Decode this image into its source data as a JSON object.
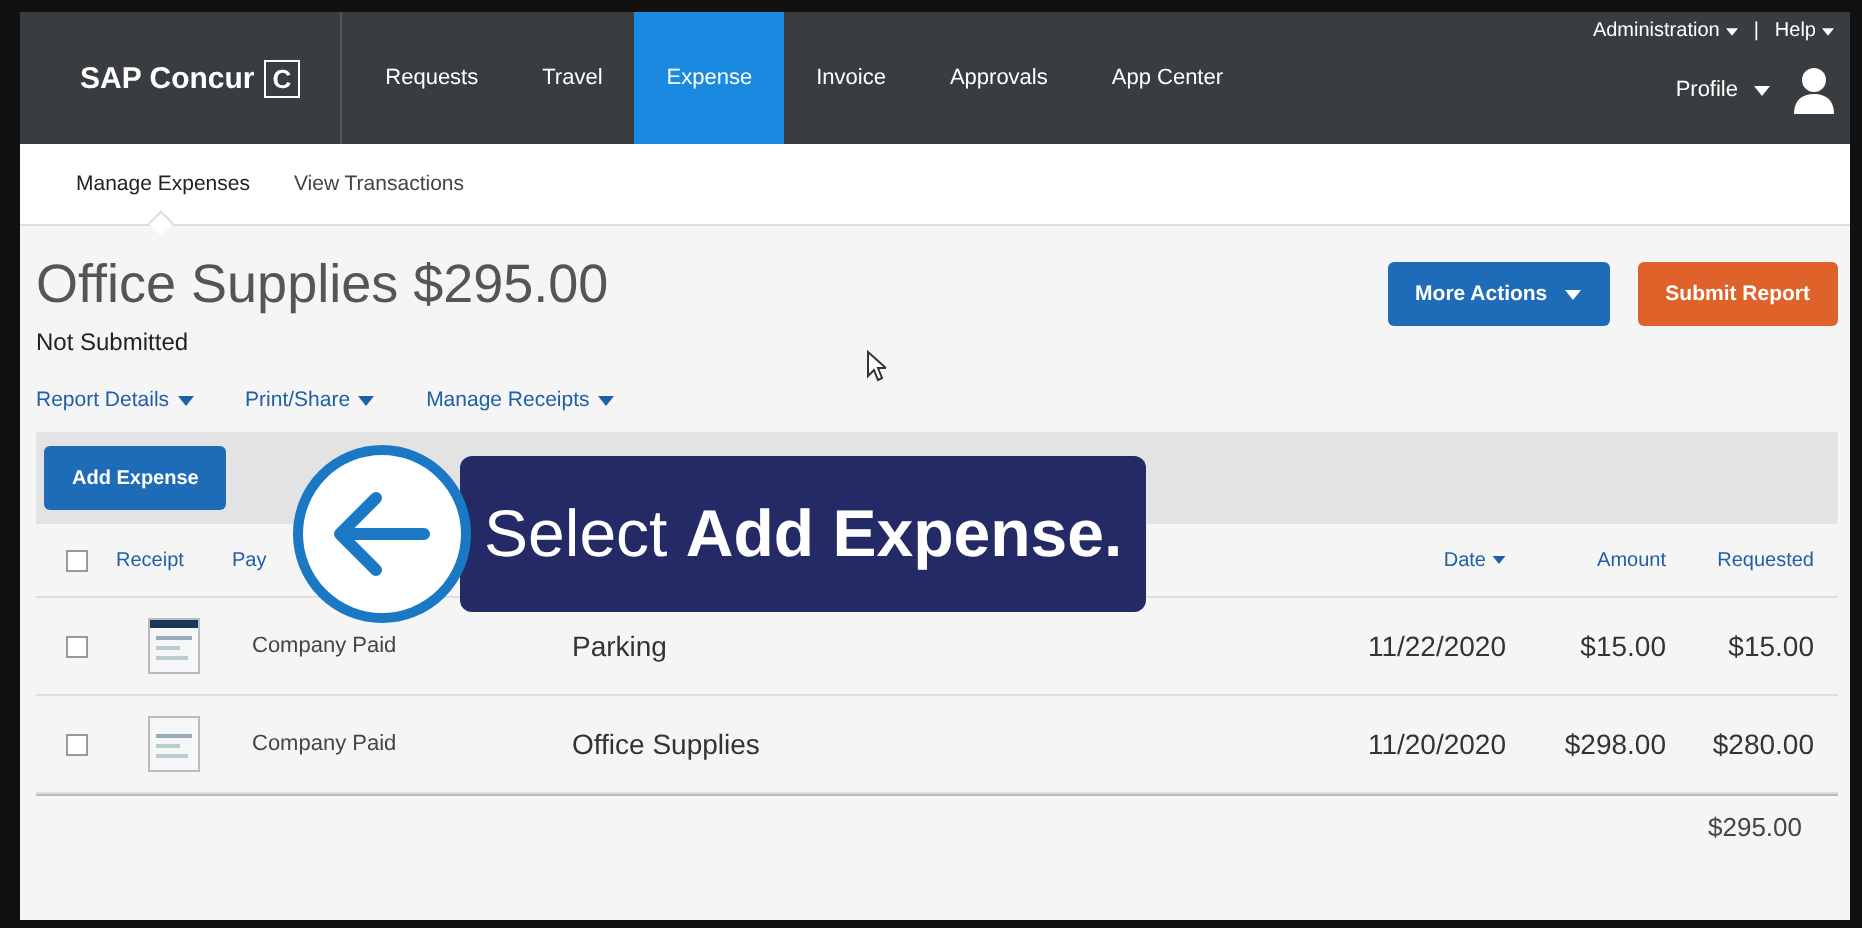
{
  "nav": {
    "brand": "SAP Concur",
    "brand_mark": "C",
    "tabs": [
      {
        "label": "Requests",
        "selected": false
      },
      {
        "label": "Travel",
        "selected": false
      },
      {
        "label": "Expense",
        "selected": true
      },
      {
        "label": "Invoice",
        "selected": false
      },
      {
        "label": "Approvals",
        "selected": false
      },
      {
        "label": "App Center",
        "selected": false
      }
    ],
    "admin": "Administration",
    "separator": "|",
    "help": "Help",
    "profile": "Profile"
  },
  "subnav": [
    {
      "label": "Manage Expenses",
      "selected": true
    },
    {
      "label": "View Transactions",
      "selected": false
    }
  ],
  "report": {
    "title": "Office Supplies $295.00",
    "status": "Not Submitted",
    "more_actions": "More Actions",
    "submit": "Submit Report"
  },
  "menus": [
    "Report Details",
    "Print/Share",
    "Manage Receipts"
  ],
  "toolbar": {
    "add_expense": "Add Expense"
  },
  "table": {
    "select_all_checked": false,
    "columns": [
      "Receipt",
      "Pay",
      "Date",
      "Amount",
      "Requested"
    ],
    "rows": [
      {
        "checked": false,
        "payment": "Company Paid",
        "expense_type": "Parking",
        "date": "11/22/2020",
        "amount": "$15.00",
        "requested": "$15.00"
      },
      {
        "checked": false,
        "payment": "Company Paid",
        "expense_type": "Office Supplies",
        "date": "11/20/2020",
        "amount": "$298.00",
        "requested": "$280.00"
      }
    ],
    "total": "$295.00"
  },
  "callout": {
    "text": "Select **Add Expense.**"
  }
}
